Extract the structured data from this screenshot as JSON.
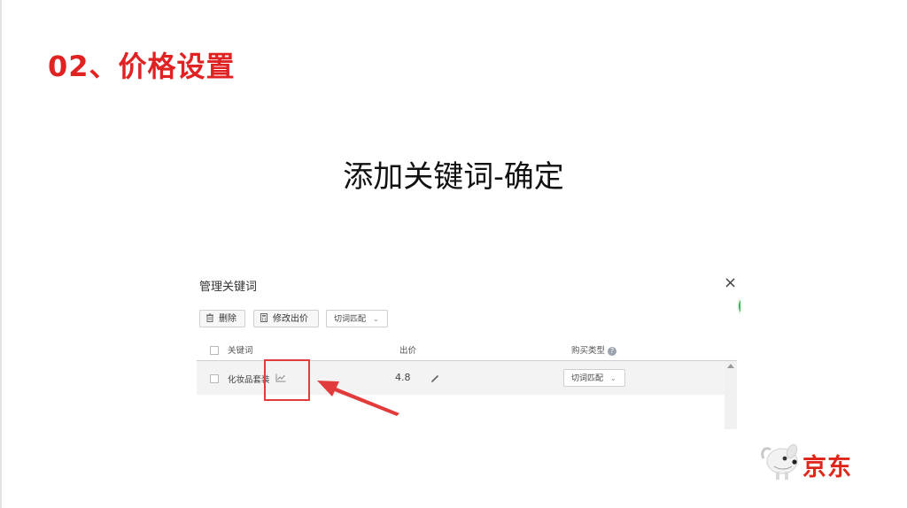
{
  "slide": {
    "heading": "02、价格设置",
    "subtitle": "添加关键词-确定"
  },
  "panel": {
    "title": "管理关键词",
    "close_glyph": "×",
    "toolbar": {
      "delete_label": "删除",
      "modify_bid_label": "修改出价",
      "match_type_value": "切词匹配",
      "chevron": "⌄"
    },
    "table": {
      "headers": {
        "keyword": "关键词",
        "bid": "出价",
        "purchase_type": "购买类型",
        "help_glyph": "?"
      },
      "rows": [
        {
          "keyword": "化妆品套装",
          "bid": "4.8",
          "match_type": "切词匹配"
        }
      ]
    }
  },
  "brand": {
    "logo_text": "京东"
  },
  "colors": {
    "heading_red": "#e02222",
    "highlight_red": "#e23b3b",
    "badge_green": "#2db34a"
  },
  "icons": [
    "trash-icon",
    "calculator-icon",
    "chevron-down-icon",
    "help-icon",
    "trend-chart-icon",
    "pencil-icon",
    "close-icon",
    "jd-dog-mascot-icon"
  ]
}
